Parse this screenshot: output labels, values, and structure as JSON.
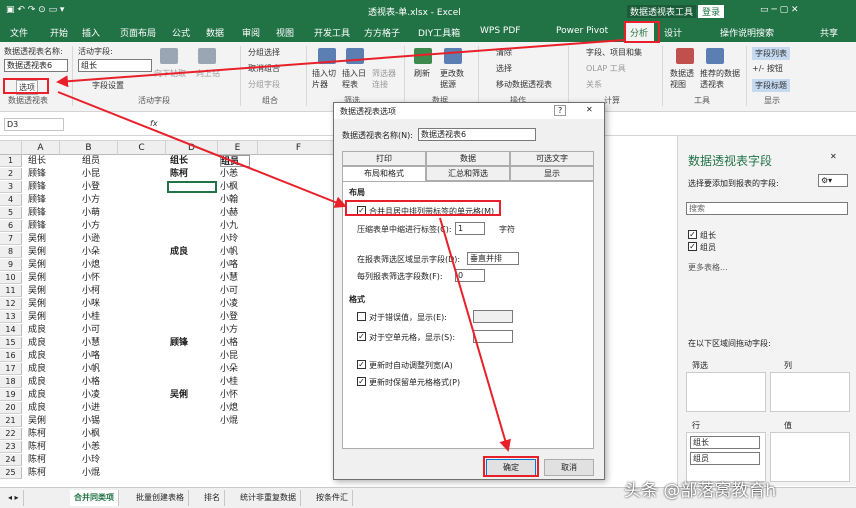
{
  "titlebar": {
    "filename": "透视表-单.xlsx - Excel",
    "context": "数据透视表工具",
    "login": "登录"
  },
  "tabs": [
    "文件",
    "开始",
    "插入",
    "页面布局",
    "公式",
    "数据",
    "审阅",
    "视图",
    "开发工具",
    "方方格子",
    "DIY工具箱",
    "WPS PDF",
    "Power Pivot",
    "分析",
    "设计",
    "操作说明搜索",
    "共享"
  ],
  "ribbon": {
    "pt_name_label": "数据透视表名称:",
    "pt_name_value": "数据透视表6",
    "options_btn": "选项",
    "active_field_label": "活动字段:",
    "active_field_value": "组长",
    "field_settings": "字段设置",
    "drill_down": "向下钻取",
    "drill_up": "向上钻",
    "group_selection": "分组选择",
    "ungroup": "取消组合",
    "group_field": "分组字段",
    "insert_slicer": "插入切片器",
    "insert_timeline": "插入日程表",
    "filter_conn": "筛选器连接",
    "refresh": "刷新",
    "change_source": "更改数据源",
    "clear": "清除",
    "select": "选择",
    "move_pt": "移动数据透视表",
    "fields_items": "字段、项目和集",
    "olap": "OLAP 工具",
    "relations": "关系",
    "pivot_chart": "数据透视图",
    "recommended": "推荐的数据透视表",
    "field_list": "字段列表",
    "plus_minus": "+/- 按钮",
    "field_headers": "字段标题",
    "groups": [
      "数据透视表",
      "活动字段",
      "组合",
      "筛选",
      "数据",
      "操作",
      "计算",
      "工具",
      "显示"
    ]
  },
  "formula": {
    "namebox": "D3",
    "fx": "fx"
  },
  "grid": {
    "cols": [
      "A",
      "B",
      "C",
      "D",
      "E",
      "F"
    ],
    "rows": [
      [
        "组长",
        "组员"
      ],
      [
        "顾锋",
        "小昆"
      ],
      [
        "顾锋",
        "小登"
      ],
      [
        "顾锋",
        "小方"
      ],
      [
        "顾锋",
        "小萌"
      ],
      [
        "顾锋",
        "小方"
      ],
      [
        "吴俐",
        "小逊"
      ],
      [
        "吴俐",
        "小朵"
      ],
      [
        "吴俐",
        "小熄"
      ],
      [
        "吴俐",
        "小怀"
      ],
      [
        "吴俐",
        "小柯"
      ],
      [
        "吴俐",
        "小咪"
      ],
      [
        "吴俐",
        "小桂"
      ],
      [
        "成良",
        "小可"
      ],
      [
        "成良",
        "小慧"
      ],
      [
        "成良",
        "小咯"
      ],
      [
        "成良",
        "小帆"
      ],
      [
        "成良",
        "小格"
      ],
      [
        "成良",
        "小凌"
      ],
      [
        "成良",
        "小进"
      ],
      [
        "吴俐",
        "小锡"
      ],
      [
        "陈柯",
        "小枫"
      ],
      [
        "陈柯",
        "小恙"
      ],
      [
        "陈柯",
        "小玲"
      ],
      [
        "陈柯",
        "小焜"
      ]
    ],
    "pivot": {
      "h1": "组长",
      "h2": "组员",
      "groups": [
        {
          "name": "陈柯",
          "row": 2
        },
        {
          "name": "成良",
          "row": 8
        },
        {
          "name": "顾锋",
          "row": 15
        },
        {
          "name": "吴俐",
          "row": 19
        }
      ],
      "members": [
        "小恙",
        "小枫",
        "小翰",
        "小赫",
        "小九",
        "小玲",
        "小帆",
        "小咯",
        "小慧",
        "小可",
        "小凌",
        "小登",
        "小方",
        "小格",
        "小昆",
        "小朵",
        "小桂",
        "小怀",
        "小熄",
        "小焜"
      ]
    }
  },
  "dialog": {
    "title": "数据透视表选项",
    "help": "?",
    "name_label": "数据透视表名称(N):",
    "name_value": "数据透视表6",
    "tabs_row1": [
      "打印",
      "数据",
      "可选文字"
    ],
    "tabs_row2": [
      "布局和格式",
      "汇总和筛选",
      "显示"
    ],
    "section_layout": "布局",
    "merge_label": "合并且居中排列带标签的单元格(M)",
    "indent_label": "压缩表单中缩进行标签(C):",
    "indent_value": "1",
    "indent_unit": "字符",
    "filter_area_label": "在报表筛选区域显示字段(D):",
    "filter_area_value": "垂直并排",
    "filter_count_label": "每列报表筛选字段数(F):",
    "filter_count_value": "0",
    "section_format": "格式",
    "error_label": "对于错误值，显示(E):",
    "empty_label": "对于空单元格，显示(S):",
    "autofit_label": "更新时自动调整列宽(A)",
    "preserve_label": "更新时保留单元格格式(P)",
    "ok": "确定",
    "cancel": "取消"
  },
  "pane": {
    "title": "数据透视表字段",
    "choose": "选择要添加到报表的字段:",
    "search": "搜索",
    "fields": [
      "组长",
      "组员"
    ],
    "more": "更多表格...",
    "drag": "在以下区域间拖动字段:",
    "filters": "筛选",
    "columns": "列",
    "rows": "行",
    "values": "值",
    "row_items": [
      "组长",
      "组员"
    ]
  },
  "sheets": [
    "合并同类项",
    "批量创建表格",
    "排名",
    "统计非重复数据",
    "按条件汇"
  ],
  "watermark": "头条 @部落窝教育h"
}
